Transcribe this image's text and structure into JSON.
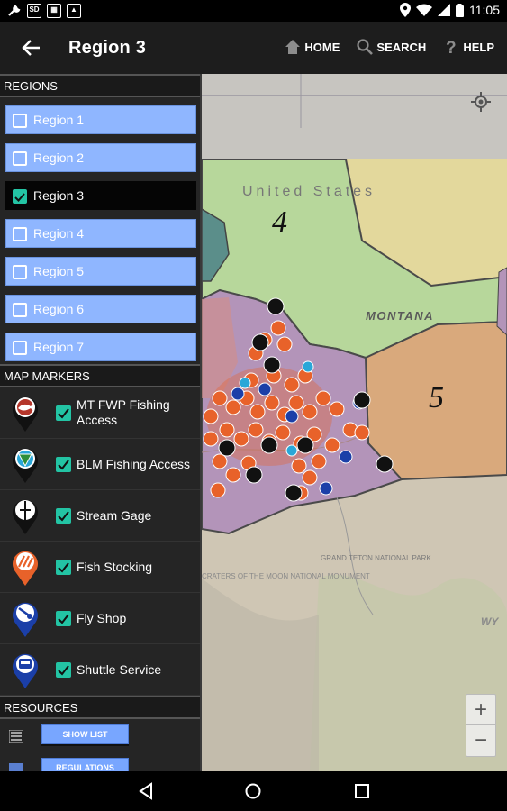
{
  "status_bar": {
    "time": "11:05"
  },
  "app_bar": {
    "title": "Region 3",
    "actions": [
      {
        "id": "home",
        "label": "HOME",
        "icon": "home-icon"
      },
      {
        "id": "search",
        "label": "SEARCH",
        "icon": "search-icon"
      },
      {
        "id": "help",
        "label": "HELP",
        "icon": "help-icon"
      }
    ]
  },
  "panel": {
    "regions_header": "REGIONS",
    "regions": [
      {
        "label": "Region 1",
        "checked": false
      },
      {
        "label": "Region 2",
        "checked": false
      },
      {
        "label": "Region 3",
        "checked": true
      },
      {
        "label": "Region 4",
        "checked": false
      },
      {
        "label": "Region 5",
        "checked": false
      },
      {
        "label": "Region 6",
        "checked": false
      },
      {
        "label": "Region 7",
        "checked": false
      }
    ],
    "markers_header": "MAP MARKERS",
    "markers": [
      {
        "label": "MT FWP Fishing Access",
        "checked": true,
        "icon": "fwp-fishing-access-icon",
        "color": "#b5362b"
      },
      {
        "label": "BLM Fishing Access",
        "checked": true,
        "icon": "blm-fishing-access-icon",
        "color": "#2aa7d8"
      },
      {
        "label": "Stream Gage",
        "checked": true,
        "icon": "stream-gage-icon",
        "color": "#111111"
      },
      {
        "label": "Fish Stocking",
        "checked": true,
        "icon": "fish-stocking-icon",
        "color": "#e8622a"
      },
      {
        "label": "Fly Shop",
        "checked": true,
        "icon": "fly-shop-icon",
        "color": "#1b3fa8"
      },
      {
        "label": "Shuttle Service",
        "checked": true,
        "icon": "shuttle-service-icon",
        "color": "#1b3fa8"
      }
    ],
    "resources_header": "RESOURCES",
    "resources": [
      {
        "label": "SHOW LIST",
        "icon": "list-icon"
      },
      {
        "label": "REGULATIONS",
        "icon": "checkbox-icon"
      }
    ]
  },
  "map": {
    "labels": {
      "country": "United States",
      "state": "MONTANA",
      "region4": "4",
      "region5": "5",
      "park": "GRAND TETON NATIONAL PARK",
      "monument": "CRATERS OF THE MOON NATIONAL MONUMENT",
      "wy": "WY"
    },
    "zoom_in": "+",
    "zoom_out": "−"
  },
  "colors": {
    "region_blue": "#8fb6ff",
    "checkbox_teal": "#23c4a4",
    "region3_fill": "#b394b9",
    "region4_fill": "#b7d79b",
    "region5_fill": "#d9a97c"
  }
}
